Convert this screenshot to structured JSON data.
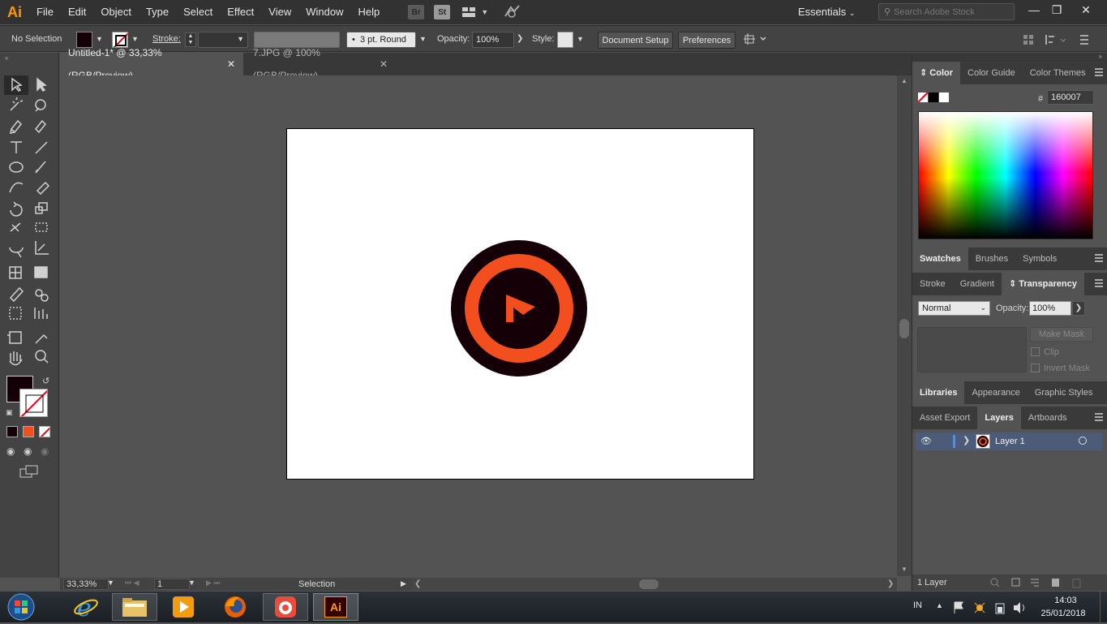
{
  "app": {
    "logo": "Ai"
  },
  "menu": [
    "File",
    "Edit",
    "Object",
    "Type",
    "Select",
    "Effect",
    "View",
    "Window",
    "Help"
  ],
  "menu_icons": {
    "bridge": "Br",
    "stock": "St"
  },
  "workspace": "Essentials",
  "search": {
    "placeholder": "Search Adobe Stock"
  },
  "control": {
    "selection_label": "No Selection",
    "stroke_label": "Stroke:",
    "brush_value": "3 pt. Round",
    "opacity_label": "Opacity:",
    "opacity_value": "100%",
    "style_label": "Style:",
    "document_setup": "Document Setup",
    "preferences": "Preferences"
  },
  "tabs": [
    {
      "label": "Untitled-1* @ 33,33% (RGB/Preview)",
      "active": true
    },
    {
      "label": "7.JPG @ 100% (RGB/Preview)",
      "active": false
    }
  ],
  "status": {
    "zoom": "33,33%",
    "artboard": "1",
    "tool": "Selection"
  },
  "colors": {
    "fill": "#160007",
    "accent_orange": "#f24e1e",
    "dark": "#160007"
  },
  "color_panel": {
    "tabs": [
      "Color",
      "Color Guide",
      "Color Themes"
    ],
    "hex_label": "#",
    "hex_value": "160007"
  },
  "swatches_tabs": [
    "Swatches",
    "Brushes",
    "Symbols"
  ],
  "transparency": {
    "tabs": [
      "Stroke",
      "Gradient",
      "Transparency"
    ],
    "blend_mode": "Normal",
    "opacity_label": "Opacity:",
    "opacity_value": "100%",
    "make_mask": "Make Mask",
    "clip": "Clip",
    "invert_mask": "Invert Mask"
  },
  "libraries_tabs": [
    "Libraries",
    "Appearance",
    "Graphic Styles"
  ],
  "layers": {
    "tabs": [
      "Asset Export",
      "Layers",
      "Artboards"
    ],
    "items": [
      {
        "name": "Layer 1"
      }
    ],
    "count": "1 Layer"
  },
  "taskbar": {
    "lang": "IN",
    "time": "14:03",
    "date": "25/01/2018",
    "ai_label": "Ai"
  }
}
